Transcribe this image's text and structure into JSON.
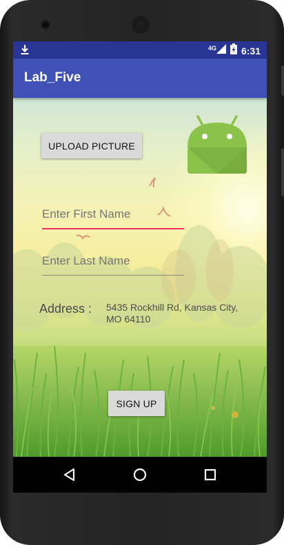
{
  "status_bar": {
    "time": "6:31",
    "network": "4G",
    "notification_icon": "download-icon",
    "signal_icon": "cell-signal-icon",
    "battery_icon": "battery-charging-icon"
  },
  "app_bar": {
    "title": "Lab_Five",
    "color": "#3f51b5",
    "status_color": "#283593"
  },
  "form": {
    "upload_button": "UPLOAD PICTURE",
    "first_name_placeholder": "Enter First Name",
    "last_name_placeholder": "Enter Last Name",
    "address_label": "Address :",
    "address_value": "5435 Rockhill Rd, Kansas City, MO 64110",
    "signup_button": "SIGN UP",
    "focus_underline_color": "#ef2d63"
  },
  "nav_bar": {
    "back_icon": "back-triangle-icon",
    "home_icon": "home-circle-icon",
    "recents_icon": "recents-square-icon"
  }
}
